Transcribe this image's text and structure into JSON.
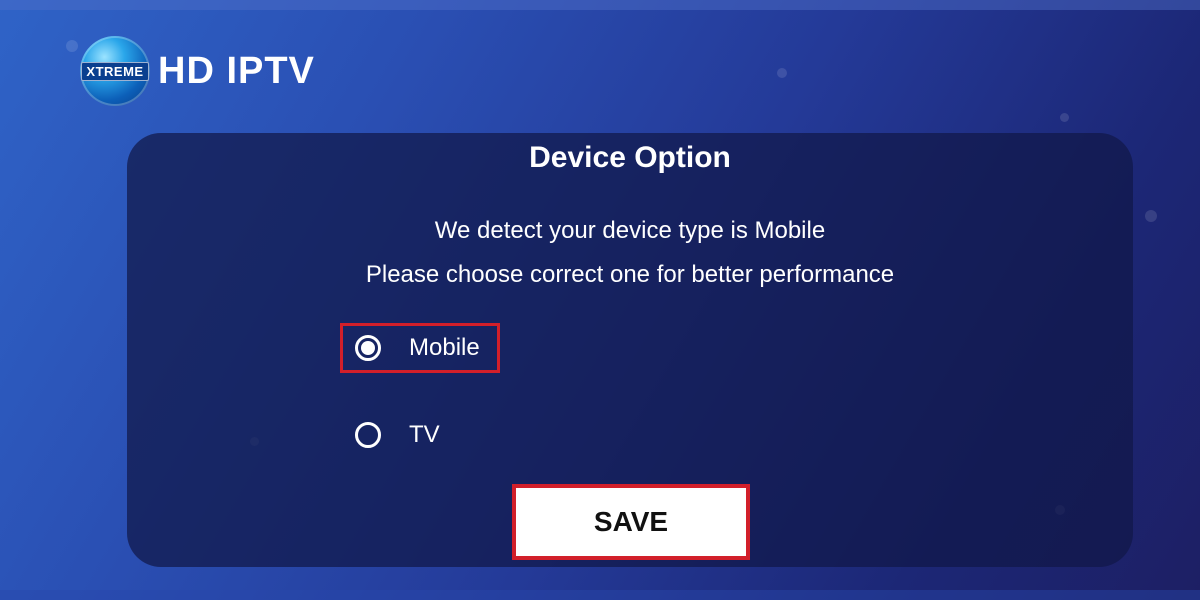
{
  "app": {
    "logo_badge_text": "XTREME",
    "logo_title": "HD IPTV"
  },
  "dialog": {
    "title": "Device Option",
    "message_line1": "We detect your device type is Mobile",
    "message_line2": "Please choose correct one for better performance",
    "options": [
      {
        "label": "Mobile",
        "selected": true
      },
      {
        "label": "TV",
        "selected": false
      }
    ],
    "save_label": "SAVE"
  },
  "colors": {
    "highlight": "#d21f2a",
    "text": "#ffffff"
  }
}
